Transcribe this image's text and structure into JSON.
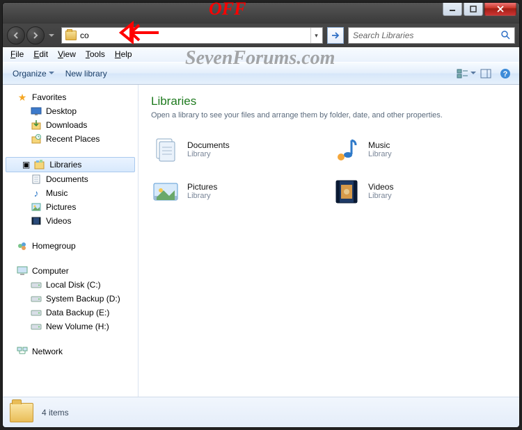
{
  "annotations": {
    "off": "OFF",
    "watermark": "SevenForums.com"
  },
  "caption_buttons": {
    "min": "minimize",
    "max": "maximize",
    "close": "close"
  },
  "address": {
    "value": "co",
    "dropdown": "▾"
  },
  "search": {
    "placeholder": "Search Libraries"
  },
  "menus": {
    "file": "File",
    "edit": "Edit",
    "view": "View",
    "tools": "Tools",
    "help": "Help"
  },
  "toolbar": {
    "organize": "Organize",
    "new_library": "New library"
  },
  "nav": {
    "favorites": {
      "label": "Favorites",
      "items": [
        "Desktop",
        "Downloads",
        "Recent Places"
      ]
    },
    "libraries": {
      "label": "Libraries",
      "items": [
        "Documents",
        "Music",
        "Pictures",
        "Videos"
      ]
    },
    "homegroup": {
      "label": "Homegroup"
    },
    "computer": {
      "label": "Computer",
      "items": [
        "Local Disk (C:)",
        "System Backup (D:)",
        "Data Backup (E:)",
        "New Volume (H:)"
      ]
    },
    "network": {
      "label": "Network"
    }
  },
  "content": {
    "title": "Libraries",
    "hint": "Open a library to see your files and arrange them by folder, date, and other properties.",
    "sub": "Library",
    "tiles": [
      {
        "name": "Documents"
      },
      {
        "name": "Music"
      },
      {
        "name": "Pictures"
      },
      {
        "name": "Videos"
      }
    ]
  },
  "status": {
    "text": "4 items"
  }
}
